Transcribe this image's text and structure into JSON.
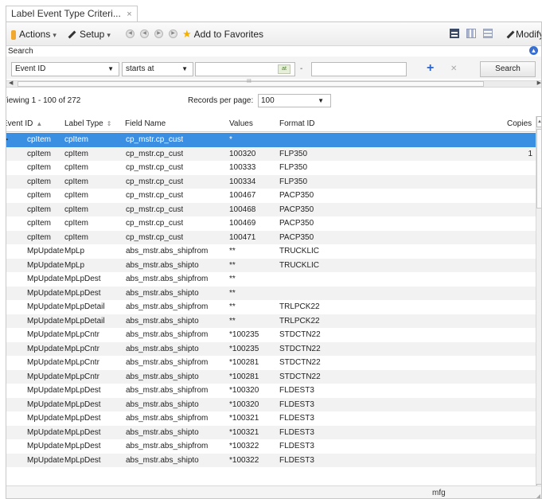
{
  "tab": {
    "title": "Label Event Type Criteri...",
    "close": "×"
  },
  "toolbar": {
    "actions_label": "Actions",
    "setup_label": "Setup",
    "favorites_label": "Add to Favorites",
    "modify_label": "Modify",
    "caret": "▾"
  },
  "search": {
    "title": "Search",
    "field_value": "Event ID",
    "operator_value": "starts at",
    "value_from": "",
    "range_separator": "-",
    "value_to": "",
    "button_label": "Search",
    "grip": "III"
  },
  "paging": {
    "viewing": "Viewing 1 - 100 of 272",
    "records_label": "Records per page:",
    "records_value": "100"
  },
  "grid": {
    "columns": [
      "Event ID",
      "Label Type",
      "Field Name",
      "Values",
      "Format ID",
      "Copies"
    ],
    "rows": [
      [
        "cpItem",
        "cpItem",
        "cp_mstr.cp_cust",
        "*",
        "",
        ""
      ],
      [
        "cpItem",
        "cpItem",
        "cp_mstr.cp_cust",
        "100320",
        "FLP350",
        "1"
      ],
      [
        "cpItem",
        "cpItem",
        "cp_mstr.cp_cust",
        "100333",
        "FLP350",
        ""
      ],
      [
        "cpItem",
        "cpItem",
        "cp_mstr.cp_cust",
        "100334",
        "FLP350",
        ""
      ],
      [
        "cpItem",
        "cpItem",
        "cp_mstr.cp_cust",
        "100467",
        "PACP350",
        ""
      ],
      [
        "cpItem",
        "cpItem",
        "cp_mstr.cp_cust",
        "100468",
        "PACP350",
        ""
      ],
      [
        "cpItem",
        "cpItem",
        "cp_mstr.cp_cust",
        "100469",
        "PACP350",
        ""
      ],
      [
        "cpItem",
        "cpItem",
        "cp_mstr.cp_cust",
        "100471",
        "PACP350",
        ""
      ],
      [
        "MpUpdate",
        "MpLp",
        "abs_mstr.abs_shipfrom",
        "**",
        "TRUCKLIC",
        ""
      ],
      [
        "MpUpdate",
        "MpLp",
        "abs_mstr.abs_shipto",
        "**",
        "TRUCKLIC",
        ""
      ],
      [
        "MpUpdate",
        "MpLpDest",
        "abs_mstr.abs_shipfrom",
        "**",
        "",
        ""
      ],
      [
        "MpUpdate",
        "MpLpDest",
        "abs_mstr.abs_shipto",
        "**",
        "",
        ""
      ],
      [
        "MpUpdate",
        "MpLpDetail",
        "abs_mstr.abs_shipfrom",
        "**",
        "TRLPCK22",
        ""
      ],
      [
        "MpUpdate",
        "MpLpDetail",
        "abs_mstr.abs_shipto",
        "**",
        "TRLPCK22",
        ""
      ],
      [
        "MpUpdate",
        "MpLpCntr",
        "abs_mstr.abs_shipfrom",
        "*100235",
        "STDCTN22",
        ""
      ],
      [
        "MpUpdate",
        "MpLpCntr",
        "abs_mstr.abs_shipto",
        "*100235",
        "STDCTN22",
        ""
      ],
      [
        "MpUpdate",
        "MpLpCntr",
        "abs_mstr.abs_shipfrom",
        "*100281",
        "STDCTN22",
        ""
      ],
      [
        "MpUpdate",
        "MpLpCntr",
        "abs_mstr.abs_shipto",
        "*100281",
        "STDCTN22",
        ""
      ],
      [
        "MpUpdate",
        "MpLpDest",
        "abs_mstr.abs_shipfrom",
        "*100320",
        "FLDEST3",
        ""
      ],
      [
        "MpUpdate",
        "MpLpDest",
        "abs_mstr.abs_shipto",
        "*100320",
        "FLDEST3",
        ""
      ],
      [
        "MpUpdate",
        "MpLpDest",
        "abs_mstr.abs_shipfrom",
        "*100321",
        "FLDEST3",
        ""
      ],
      [
        "MpUpdate",
        "MpLpDest",
        "abs_mstr.abs_shipto",
        "*100321",
        "FLDEST3",
        ""
      ],
      [
        "MpUpdate",
        "MpLpDest",
        "abs_mstr.abs_shipfrom",
        "*100322",
        "FLDEST3",
        ""
      ],
      [
        "MpUpdate",
        "MpLpDest",
        "abs_mstr.abs_shipto",
        "*100322",
        "FLDEST3",
        ""
      ]
    ]
  },
  "status": {
    "domain": "mfg"
  },
  "colors": {
    "selected_row": "#3b8fe3",
    "accent": "#2c63c8",
    "star": "#f4b000"
  },
  "icons": [
    "actions-icon",
    "pencil-icon",
    "nav-first-icon",
    "nav-prev-icon",
    "nav-next-icon",
    "nav-last-icon",
    "star-icon",
    "grid-view-icon",
    "browse-view-icon",
    "tile-view-icon",
    "calendar-icon",
    "add-icon",
    "remove-icon",
    "collapse-icon"
  ]
}
